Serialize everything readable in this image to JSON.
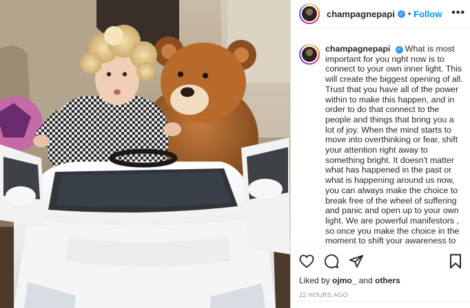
{
  "post": {
    "username": "champagnepapi",
    "follow_label": "Follow",
    "separator": "•",
    "more_label": "•••",
    "caption": "What is most important for you right now is to connect to your own inner light. This will create the biggest opening of all. Trust that you have all of the power within to make this happen, and in order to do that connect to the people and things that bring you a lot of joy. When the mind starts to move into overthinking or fear, shift your attention right away to something bright. It doesn't matter what has happened in the past or what is happening around us now, you can always make the choice to break free of the wheel of suffering and panic and open up to your own light. We are powerful manifestors , so once you make the choice in the moment to shift your awareness to something good, it will show you in your reality",
    "likes_prefix": "Liked by",
    "likes_user": "ojmo_",
    "likes_suffix": "and",
    "likes_others": "others",
    "timestamp": "22 HOURS AGO"
  },
  "icons": {
    "verified": "verified-badge-icon",
    "like": "heart-icon",
    "comment": "comment-icon",
    "share": "paper-plane-icon",
    "save": "bookmark-icon",
    "more": "ellipsis-icon"
  },
  "colors": {
    "accent": "#0095f6",
    "verified": "#3897f0",
    "text": "#262626",
    "muted": "#8e8e8e",
    "border": "#dbdbdb"
  }
}
